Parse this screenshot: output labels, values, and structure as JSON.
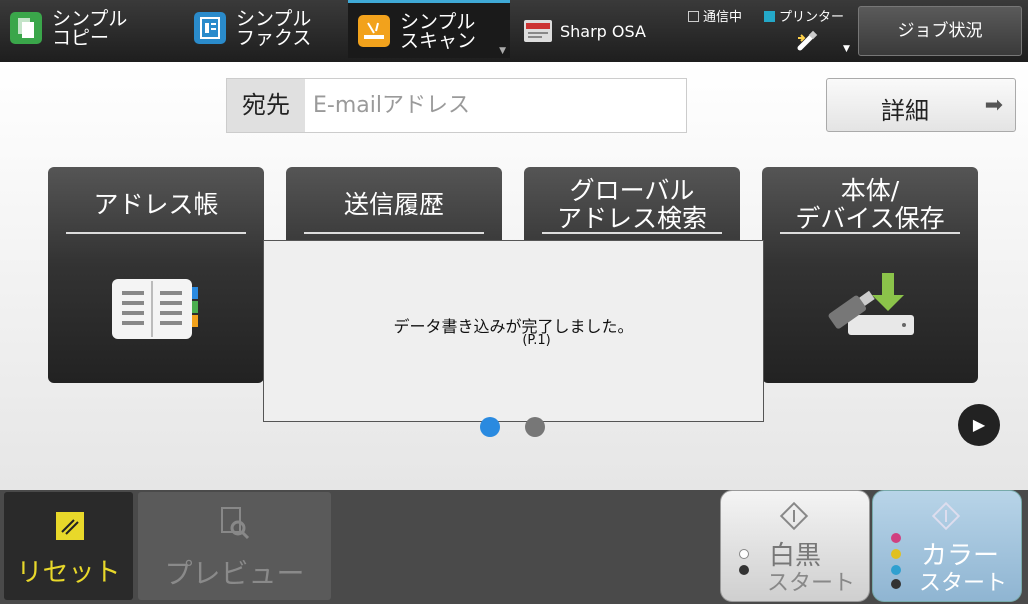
{
  "tabs": [
    {
      "label_line1": "シンプル",
      "label_line2": "コピー",
      "icon": "copy-icon"
    },
    {
      "label_line1": "シンプル",
      "label_line2": "ファクス",
      "icon": "fax-icon"
    },
    {
      "label_line1": "シンプル",
      "label_line2": "スキャン",
      "icon": "scan-icon",
      "active": true
    },
    {
      "label": "Sharp OSA",
      "icon": "osa-icon"
    }
  ],
  "status": {
    "communicating": "通信中",
    "printer": "プリンター"
  },
  "job_status_label": "ジョブ状況",
  "destination": {
    "label": "宛先",
    "placeholder": "E-mailアドレス"
  },
  "detail_button": {
    "label": "詳細",
    "arrow": "➡"
  },
  "cards": [
    {
      "title": "アドレス帳",
      "icon": "address-book-icon"
    },
    {
      "title": "送信履歴",
      "icon": "history-icon"
    },
    {
      "title": "グローバル\nアドレス検索",
      "icon": "global-search-icon"
    },
    {
      "title": "本体/\nデバイス保存",
      "icon": "usb-save-icon"
    }
  ],
  "dialog": {
    "message": "データ書き込みが完了しました。",
    "page": "(P.1)"
  },
  "pager": {
    "pages": 2,
    "current": 1
  },
  "bottom": {
    "reset": "リセット",
    "preview": "プレビュー",
    "mono_line1": "白黒",
    "mono_line2": "スタート",
    "color_line1": "カラー",
    "color_line2": "スタート"
  },
  "colors": {
    "accent": "#2a8ae0",
    "reset": "#e8d82a",
    "scan_tab_top": "#3fa9d6"
  }
}
